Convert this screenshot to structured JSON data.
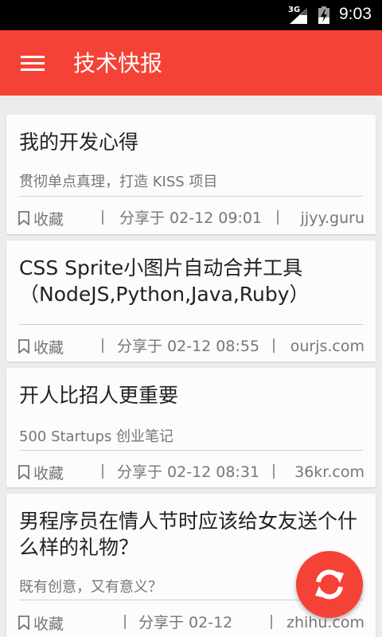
{
  "status_bar": {
    "network": "3G",
    "time": "9:03"
  },
  "app_bar": {
    "title": "技术快报"
  },
  "articles": [
    {
      "title": "我的开发心得",
      "description": "贯彻单点真理，打造 KISS 项目",
      "favorite_label": "收藏",
      "shared_at": "分享于 02-12 09:01",
      "source": "jjyy.guru"
    },
    {
      "title": "CSS Sprite小图片自动合并工具（NodeJS,Python,Java,Ruby）",
      "description": "",
      "favorite_label": "收藏",
      "shared_at": "分享于 02-12 08:55",
      "source": "ourjs.com"
    },
    {
      "title": "开人比招人更重要",
      "description": "500 Startups 创业笔记",
      "favorite_label": "收藏",
      "shared_at": "分享于 02-12 08:31",
      "source": "36kr.com"
    },
    {
      "title": "男程序员在情人节时应该给女友送个什么样的礼物？",
      "description": "既有创意，又有意义？",
      "favorite_label": "收藏",
      "shared_at": "分享于 02-12",
      "source": "zhihu.com"
    }
  ],
  "colors": {
    "accent": "#f44336",
    "status_bar": "#000000",
    "background": "#ececec",
    "card": "#fdfbfd"
  },
  "icons": {
    "menu": "menu-icon",
    "favorite": "bookmark-icon",
    "refresh": "refresh-icon"
  }
}
